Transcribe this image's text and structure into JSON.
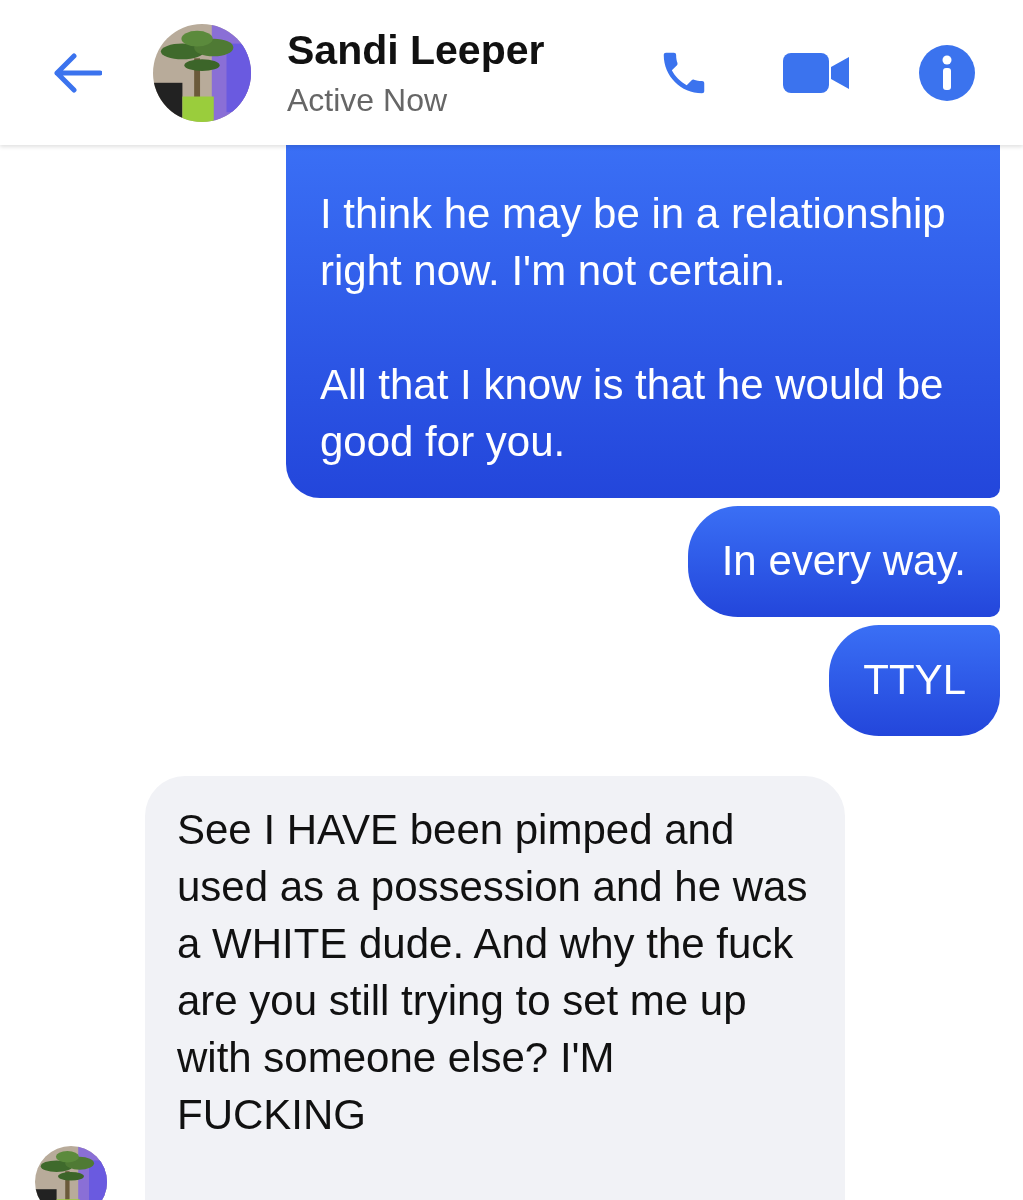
{
  "header": {
    "name": "Sandi Leeper",
    "status": "Active Now"
  },
  "messages": [
    {
      "kind": "outgoing",
      "text": "I think he may be in a relationship right now. I'm not certain.\n\nAll that I know is that he would be good for you."
    },
    {
      "kind": "outgoing",
      "text": "In every way."
    },
    {
      "kind": "outgoing",
      "text": "TTYL"
    },
    {
      "kind": "incoming",
      "text": "See I HAVE been pimped and used as a possession and he was a WHITE dude. And why the fuck are you still trying to set me up with someone else? I'M FUCKING"
    }
  ]
}
